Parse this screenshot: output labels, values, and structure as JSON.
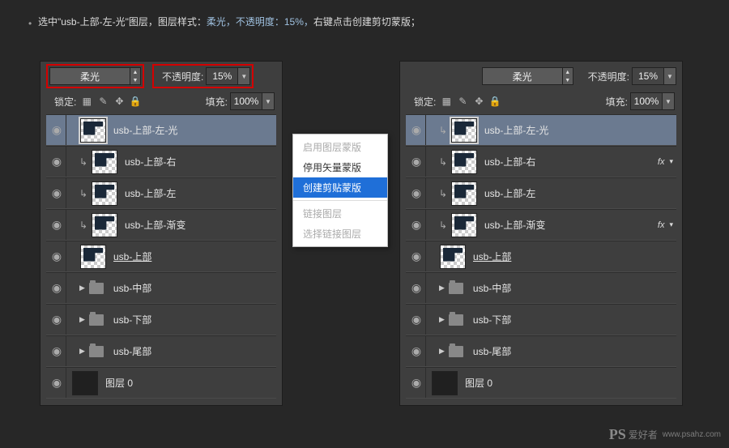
{
  "instruction": {
    "pre": "选中\"usb-上部-左-光\"图层，图层样式：",
    "hl": "柔光，不透明度：15%，",
    "post": "右键点击创建剪切蒙版；"
  },
  "controls": {
    "blend_label": "柔光",
    "opacity_label": "不透明度:",
    "opacity_value": "15%",
    "lock_label": "锁定:",
    "fill_label": "填充:",
    "fill_value": "100%"
  },
  "layers_left": [
    {
      "name": "usb-上部-左-光",
      "thumb": "checker",
      "sel": true,
      "indent": 1
    },
    {
      "name": "usb-上部-右",
      "thumb": "checker",
      "indent": 1,
      "clip": true
    },
    {
      "name": "usb-上部-左",
      "thumb": "checker",
      "indent": 1,
      "clip": true
    },
    {
      "name": "usb-上部-渐变",
      "thumb": "checker",
      "indent": 1,
      "clip": true
    },
    {
      "name": "usb-上部",
      "thumb": "checker",
      "indent": 1,
      "underline": true
    },
    {
      "name": "usb-中部",
      "folder": true,
      "indent": 1
    },
    {
      "name": "usb-下部",
      "folder": true,
      "indent": 1
    },
    {
      "name": "usb-尾部",
      "folder": true,
      "indent": 1
    },
    {
      "name": "图层 0",
      "thumb": "dark",
      "indent": 0
    }
  ],
  "layers_right": [
    {
      "name": "usb-上部-左-光",
      "thumb": "checker",
      "sel": true,
      "indent": 1,
      "clip": true
    },
    {
      "name": "usb-上部-右",
      "thumb": "checker",
      "indent": 1,
      "clip": true,
      "fx": true
    },
    {
      "name": "usb-上部-左",
      "thumb": "checker",
      "indent": 1,
      "clip": true
    },
    {
      "name": "usb-上部-渐变",
      "thumb": "checker",
      "indent": 1,
      "clip": true,
      "fx": true
    },
    {
      "name": "usb-上部",
      "thumb": "checker",
      "indent": 1,
      "underline": true
    },
    {
      "name": "usb-中部",
      "folder": true,
      "indent": 1
    },
    {
      "name": "usb-下部",
      "folder": true,
      "indent": 1
    },
    {
      "name": "usb-尾部",
      "folder": true,
      "indent": 1
    },
    {
      "name": "图层 0",
      "thumb": "dark",
      "indent": 0
    }
  ],
  "context_menu": {
    "items": [
      {
        "label": "启用图层蒙版",
        "gray": true
      },
      {
        "label": "停用矢量蒙版",
        "gray": false
      },
      {
        "label": "创建剪贴蒙版",
        "sel": true
      },
      {
        "sep": true
      },
      {
        "label": "链接图层",
        "gray": true
      },
      {
        "label": "选择链接图层",
        "gray": true
      }
    ]
  },
  "watermark": {
    "logo": "PS",
    "text": "爱好者",
    "url": "www.psahz.com"
  }
}
